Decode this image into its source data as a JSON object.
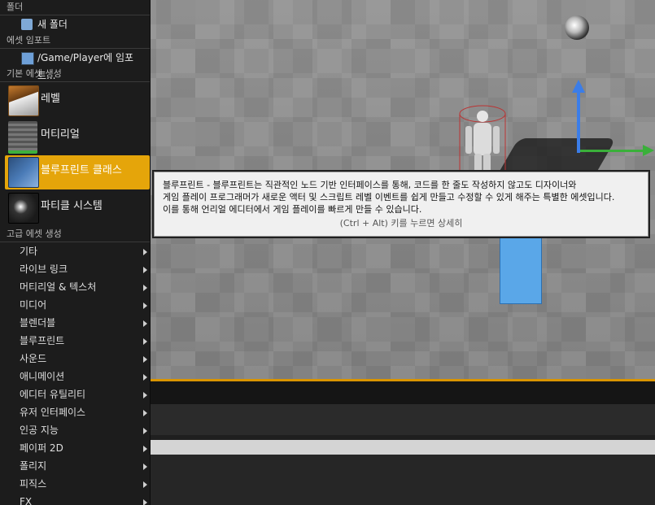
{
  "menu": {
    "section_folder": "폴더",
    "new_folder": "새 폴더",
    "section_import": "에셋 임포트",
    "import_item": "/Game/Player에 임포트...",
    "section_basic": "기본 에셋 생성",
    "basic_items": [
      "레벨",
      "머티리얼",
      "블루프린트 클래스",
      "파티클 시스템"
    ],
    "section_advanced": "고급 에셋 생성",
    "advanced_items": [
      "기타",
      "라이브 링크",
      "머티리얼 & 텍스처",
      "미디어",
      "블렌더블",
      "블루프린트",
      "사운드",
      "애니메이션",
      "에디터 유틸리티",
      "유저 인터페이스",
      "인공 지능",
      "페이퍼 2D",
      "폴리지",
      "피직스",
      "FX"
    ]
  },
  "tooltip": {
    "line1": "블루프린트 - 블루프린트는 직관적인 노드 기반 인터페이스를 통해, 코드를 한 줄도 작성하지 않고도 디자이너와",
    "line2": "게임 플레이 프로그래머가 새로운 액터 및 스크립트 레벨 이벤트를 쉽게 만들고 수정할 수 있게 해주는 특별한 에셋입니다.",
    "line3": "이를 통해 언리얼 에디터에서 게임 플레이를 빠르게 만들 수 있습니다.",
    "hint": "(Ctrl + Alt) 키를 누르면 상세히"
  },
  "colors": {
    "selection": "#e5a50a",
    "accent_line": "#d99400"
  },
  "icons": {
    "new_folder": "folder-plus-icon",
    "import": "import-icon",
    "submenu": "chevron-right-icon"
  }
}
